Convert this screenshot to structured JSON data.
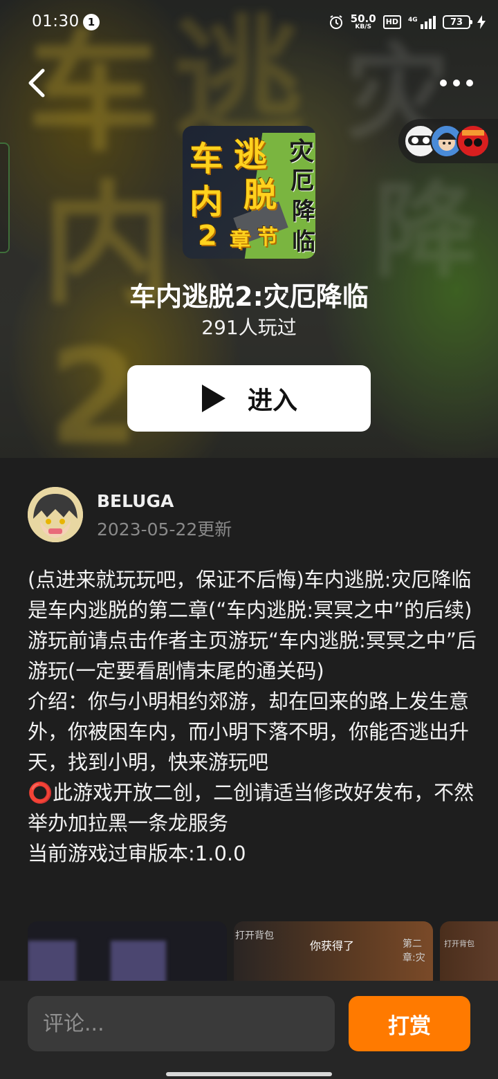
{
  "status_bar": {
    "time": "01:30",
    "notification_count": "1",
    "net_speed_value": "50.0",
    "net_speed_unit": "KB/S",
    "hd_label": "HD",
    "signal_label": "4G",
    "battery_level": "73"
  },
  "game": {
    "cover_title_chars": [
      "车",
      "内",
      "逃",
      "脱",
      "2",
      "章",
      "节",
      "灾",
      "厄",
      "降",
      "临"
    ],
    "title": "车内逃脱2:灾厄降临",
    "play_count": "291人玩过",
    "enter_label": "进入"
  },
  "author": {
    "name": "BELUGA",
    "updated": "2023-05-22更新"
  },
  "description": "(点进来就玩玩吧，保证不后悔)车内逃脱:灾厄降临 是车内逃脱的第二章(“车内逃脱:冥冥之中”的后续)游玩前请点击作者主页游玩“车内逃脱:冥冥之中”后游玩(一定要看剧情末尾的通关码)\n介绍：你与小明相约郊游，却在回来的路上发生意外，你被困车内，而小明下落不明，你能否逃出升天，找到小明，快来游玩吧\n⭕此游戏开放二创，二创请适当修改好发布，不然举办加拉黑一条龙服务\n当前游戏过审版本:1.0.0",
  "screenshots": {
    "shot2_caption_left": "打开背包",
    "shot2_caption_center": "你获得了",
    "shot2_caption_right": "第二章:灾",
    "shot3_caption": "打开背包"
  },
  "bottom_bar": {
    "comment_placeholder": "评论...",
    "tip_label": "打赏"
  },
  "colors": {
    "accent": "#ff7a00",
    "background": "#1e1e1e",
    "bottom_bar": "#262626"
  }
}
